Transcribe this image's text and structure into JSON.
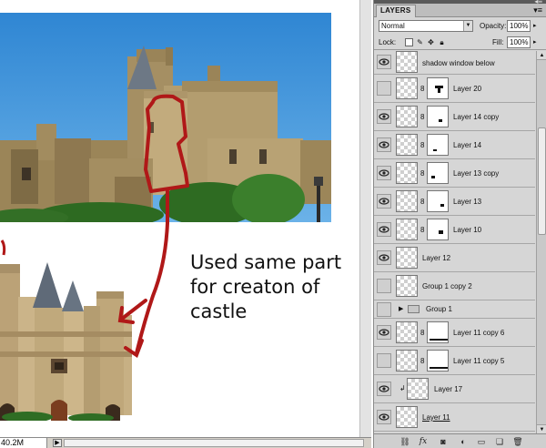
{
  "canvas": {
    "annotation_lines": [
      "Used same part",
      "for creaton of",
      "castle"
    ]
  },
  "status_bar": {
    "zoom": "40.2M",
    "nav_arrow": "▶"
  },
  "layers_panel": {
    "tab_label": "LAYERS",
    "options_icon": "panel-menu-icon",
    "blend_mode": "Normal",
    "opacity_label": "Opacity:",
    "opacity_value": "100%",
    "lock_label": "Lock:",
    "fill_label": "Fill:",
    "fill_value": "100%",
    "layers": [
      {
        "name": "shadow window below",
        "visible": true
      },
      {
        "name": "Layer 20",
        "visible": false
      },
      {
        "name": "Layer 14 copy",
        "visible": true
      },
      {
        "name": "Layer 14",
        "visible": true
      },
      {
        "name": "Layer 13 copy",
        "visible": true
      },
      {
        "name": "Layer 13",
        "visible": true
      },
      {
        "name": "Layer 10",
        "visible": true
      },
      {
        "name": "Layer 12",
        "visible": true
      },
      {
        "name": "Group 1 copy 2",
        "visible": false
      },
      {
        "name": "Group 1",
        "visible": false
      },
      {
        "name": "Layer 11 copy 6",
        "visible": true
      },
      {
        "name": "Layer 11 copy 5",
        "visible": false
      },
      {
        "name": "Layer 17",
        "visible": true
      },
      {
        "name": "Layer 11",
        "visible": true
      }
    ],
    "footer_icons": [
      "link-layers-icon",
      "fx-icon",
      "add-mask-icon",
      "adjustment-layer-icon",
      "new-group-icon",
      "new-layer-icon",
      "trash-icon"
    ]
  },
  "colors": {
    "annotation_red": "#b01818",
    "sky": "#3d95db",
    "panel_bg": "#d6d6d6"
  }
}
